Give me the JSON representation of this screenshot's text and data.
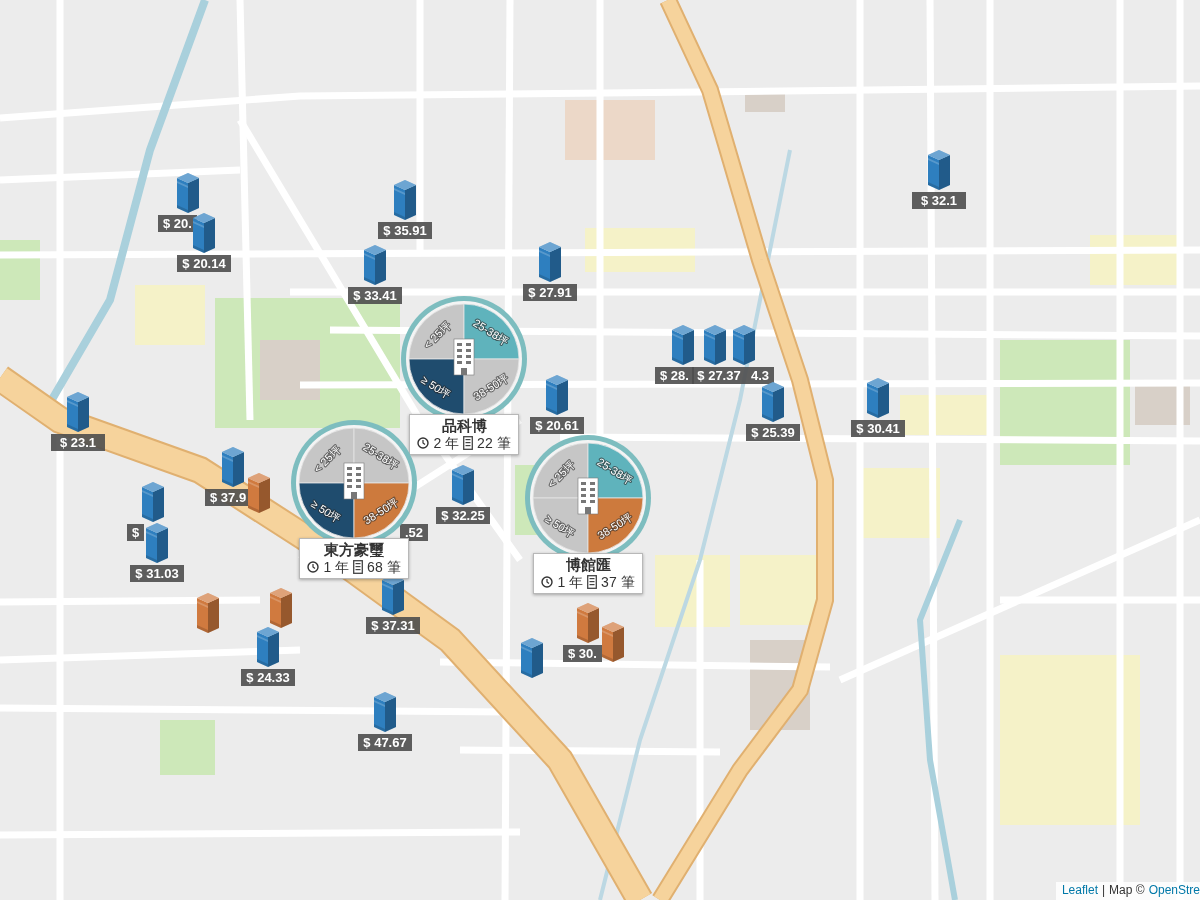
{
  "map": {
    "markers": [
      {
        "price": "$ 20.",
        "color": "#2e7fbf"
      },
      {
        "price": "$ 35.91",
        "color": "#2e7fbf"
      },
      {
        "price": "$ 32.1",
        "color": "#2e7fbf"
      },
      {
        "price": "$ 20.14",
        "color": "#2e7fbf"
      },
      {
        "price": "$ 33.41",
        "color": "#2e7fbf"
      },
      {
        "price": "$ 27.91",
        "color": "#2e7fbf"
      },
      {
        "price": "$ 28.",
        "color": "#2e7fbf"
      },
      {
        "price": "$ 27.37",
        "color": "#2e7fbf"
      },
      {
        "price": "4.3",
        "color": "#2e7fbf"
      },
      {
        "price": "$ 23.1",
        "color": "#2e7fbf"
      },
      {
        "price": "$ 20.61",
        "color": "#2e7fbf"
      },
      {
        "price": "$ 25.39",
        "color": "#2e7fbf"
      },
      {
        "price": "$ 30.41",
        "color": "#2e7fbf"
      },
      {
        "price": "$",
        "color": "#2e7fbf"
      },
      {
        "price": "$ 37.9",
        "color": "#2e7fbf"
      },
      {
        "color": "#d07a3f"
      },
      {
        "price": "$ 32.25",
        "color": "#2e7fbf"
      },
      {
        "price": "$ 31.03",
        "color": "#2e7fbf"
      },
      {
        "price": ".52"
      },
      {
        "color": "#d07a3f"
      },
      {
        "price": "$ 24.33",
        "color": "#2e7fbf"
      },
      {
        "color": "#d07a3f"
      },
      {
        "price": "$ 37.31",
        "color": "#2e7fbf"
      },
      {
        "color": "#2e7fbf"
      },
      {
        "price": "$ 30.",
        "color": "#d07a3f"
      },
      {
        "color": "#d07a3f"
      },
      {
        "price": "$ 47.67",
        "color": "#2e7fbf"
      }
    ],
    "clusters": [
      {
        "name": "品科博",
        "years": "2 年",
        "count": "22 筆",
        "segments": [
          {
            "label": "< 25坪",
            "color": "#c6c6c6"
          },
          {
            "label": "25-38坪",
            "color": "#5fb3bc"
          },
          {
            "label": "≥ 50坪",
            "color": "#1f4c6e"
          },
          {
            "label": "38-50坪",
            "color": "#c6c6c6"
          }
        ]
      },
      {
        "name": "東方豪璽",
        "years": "1 年",
        "count": "68 筆",
        "segments": [
          {
            "label": "< 25坪",
            "color": "#c6c6c6"
          },
          {
            "label": "25-38坪",
            "color": "#c6c6c6"
          },
          {
            "label": "≥ 50坪",
            "color": "#1f4c6e"
          },
          {
            "label": "38-50坪",
            "color": "#cd7a3d"
          }
        ]
      },
      {
        "name": "博館匯",
        "years": "1 年",
        "count": "37 筆",
        "segments": [
          {
            "label": "< 25坪",
            "color": "#c6c6c6"
          },
          {
            "label": "25-38坪",
            "color": "#5fb3bc"
          },
          {
            "label": "≥ 50坪",
            "color": "#c6c6c6"
          },
          {
            "label": "38-50坪",
            "color": "#cd7a3d"
          }
        ]
      }
    ]
  },
  "attribution": {
    "leaflet": "Leaflet",
    "separator": "|",
    "credit": "Map ©",
    "source": "OpenStre"
  }
}
